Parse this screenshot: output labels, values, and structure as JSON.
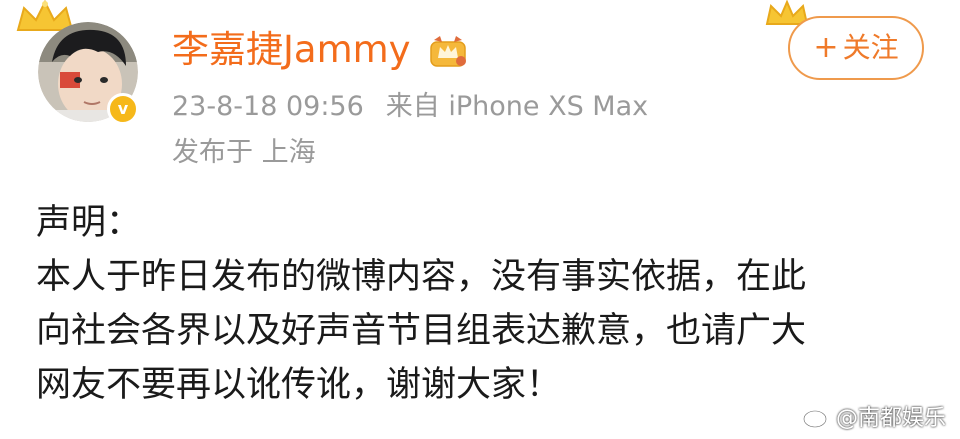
{
  "post": {
    "username": "李嘉捷Jammy",
    "timestamp": "23-8-18 09:56",
    "source": "来自 iPhone XS Max",
    "location": "发布于 上海",
    "follow_label": "关注",
    "follow_plus": "+",
    "verified_mark": "v",
    "body_lines": [
      "声明：",
      "本人于昨日发布的微博内容，没有事实依据，在此",
      "向社会各界以及好声音节目组表达歉意，也请广大",
      "网友不要再以讹传讹，谢谢大家！"
    ]
  },
  "watermark": {
    "text": "@南都娱乐",
    "icon": "weibo-logo-icon"
  },
  "colors": {
    "username": "#f36c1b",
    "meta": "#9a9a9a",
    "follow_border": "#ef9a4c",
    "verified": "#f6b81a",
    "body": "#1a1a1a"
  }
}
